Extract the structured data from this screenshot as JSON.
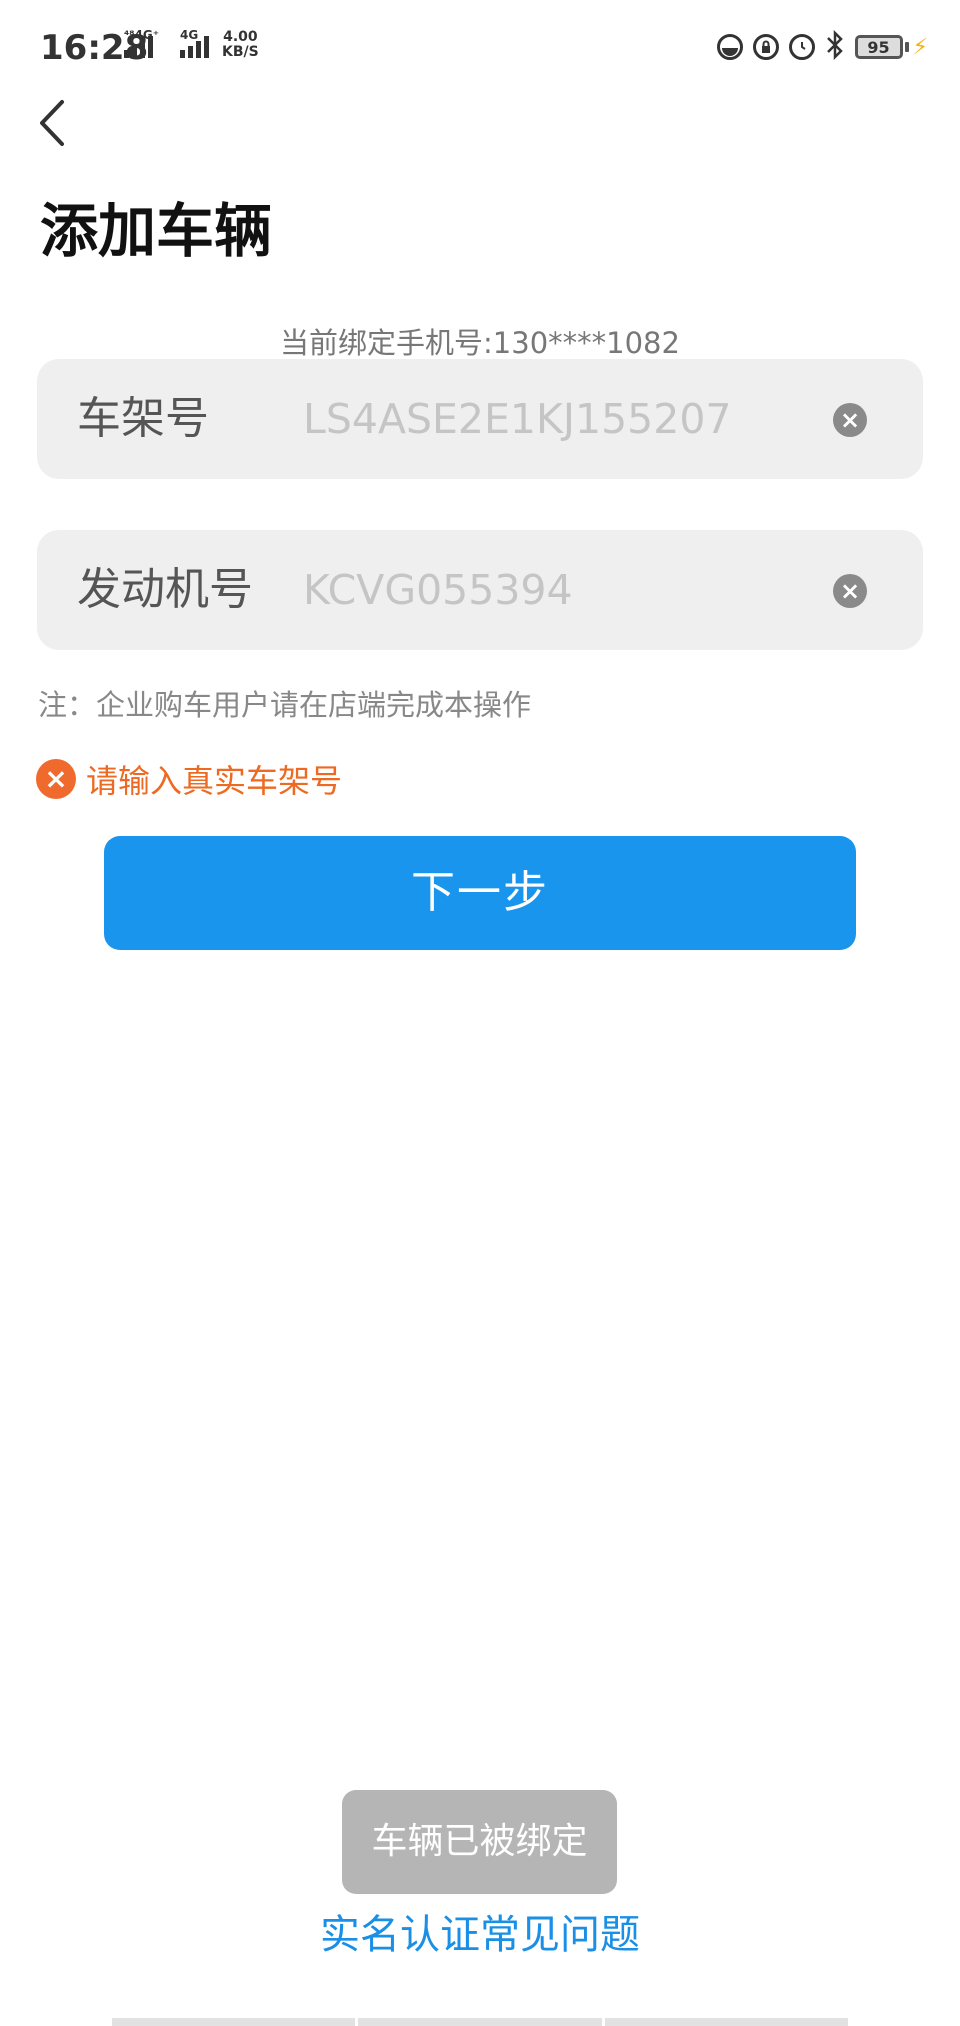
{
  "status_bar": {
    "time": "16:28",
    "sim1_label": "⁴⁸4G⁺",
    "sim2_label": "4G",
    "speed_value": "4.00",
    "speed_unit": "KB/S",
    "battery": "95"
  },
  "header": {
    "title": "添加车辆"
  },
  "bound_phone": "当前绑定手机号:130****1082",
  "form": {
    "vin": {
      "label": "车架号",
      "value": "LS4ASE2E1KJ155207"
    },
    "engine": {
      "label": "发动机号",
      "value": "KCVG055394"
    }
  },
  "note": "注：企业购车用户请在店端完成本操作",
  "error": {
    "message": "请输入真实车架号"
  },
  "next_button": "下一步",
  "toast": "车辆已被绑定",
  "faq_link": "实名认证常见问题",
  "colors": {
    "primary": "#1a95ee",
    "error": "#ee6a22",
    "link": "#1a8fe6"
  }
}
